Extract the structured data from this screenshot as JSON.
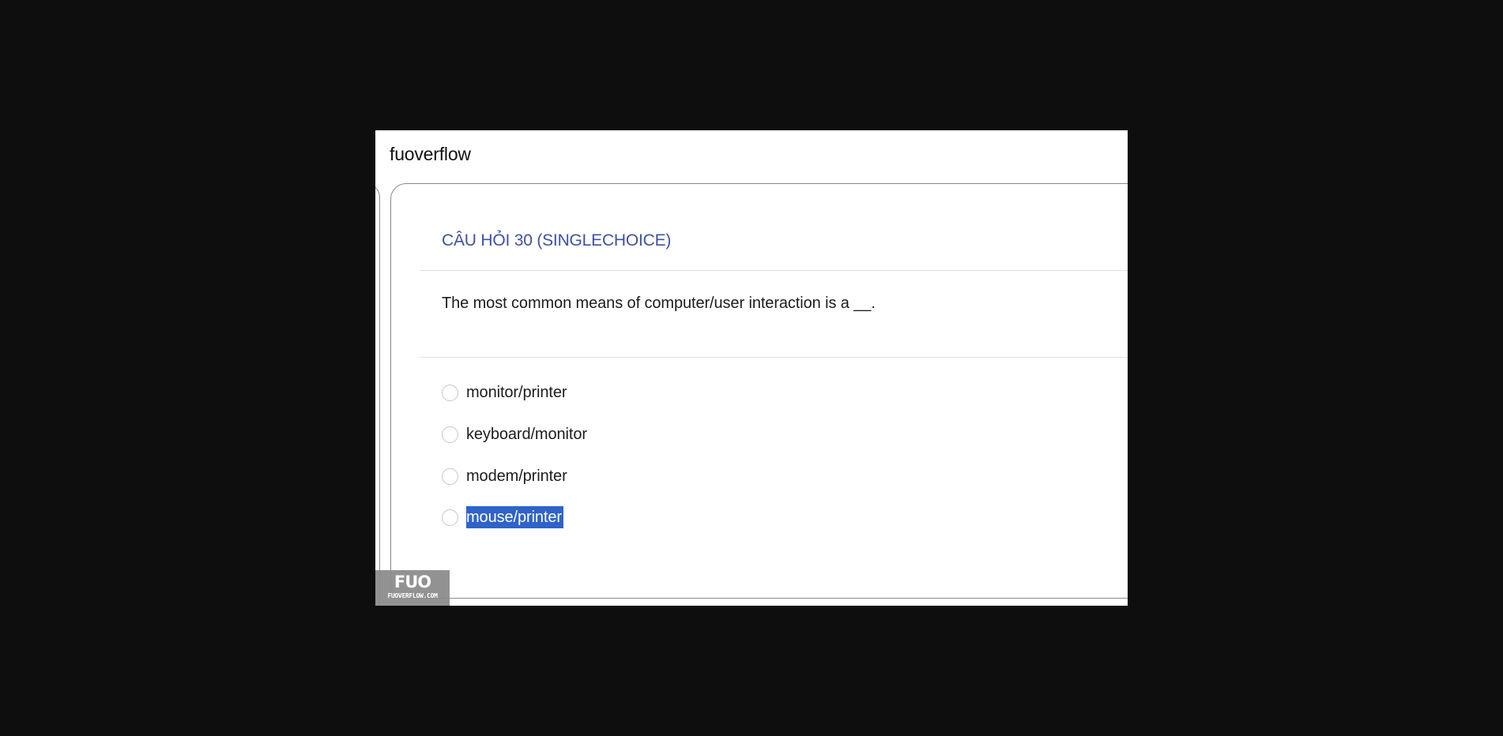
{
  "site": {
    "title": "fuoverflow"
  },
  "question": {
    "heading": "CÂU HỎI 30 (SINGLECHOICE)",
    "text": "The most common means of computer/user interaction is a __.",
    "options": [
      {
        "label": "monitor/printer",
        "selected": false
      },
      {
        "label": "keyboard/monitor",
        "selected": false
      },
      {
        "label": "modem/printer",
        "selected": false
      },
      {
        "label": "mouse/printer",
        "selected": false,
        "text_highlighted": true
      }
    ]
  },
  "watermark": {
    "logo": "FUO",
    "domain": "FUOVERFLOW.COM"
  },
  "colors": {
    "page_background": "#0e0e0e",
    "heading": "#3f51a3",
    "selection_highlight": "#2f63c9"
  }
}
